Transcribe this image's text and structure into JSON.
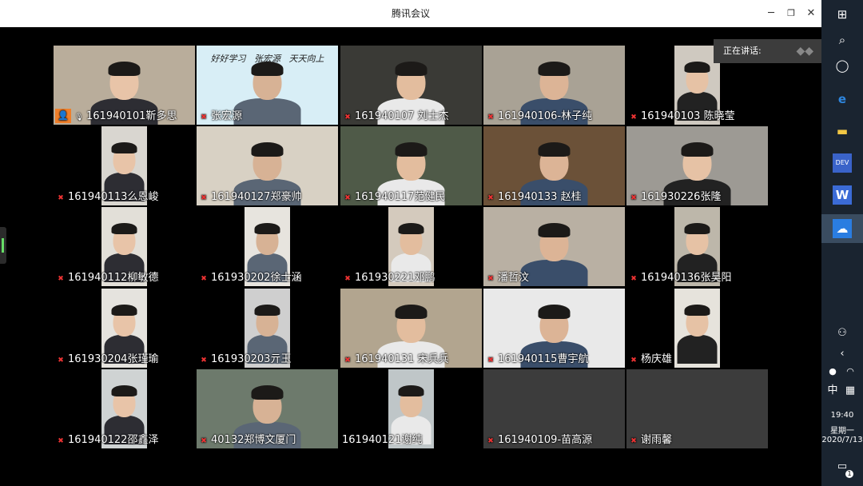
{
  "window": {
    "title": "腾讯会议",
    "minimize": "─",
    "restore": "❐",
    "close": "✕"
  },
  "speaking": {
    "label": "正在讲话:"
  },
  "participants": [
    {
      "name": "161940101靳多思",
      "bg": "#b9ad9b",
      "host": true,
      "mic": "on"
    },
    {
      "name": "张宏源",
      "bg": "#d8eef6",
      "mic": "muted",
      "banner": "好好学习   张宏源   天天向上"
    },
    {
      "name": "161940107  刘士杰",
      "bg": "#3a3a36",
      "mic": "muted"
    },
    {
      "name": "161940106-林子纯",
      "bg": "#a9a295",
      "mic": "muted"
    },
    {
      "name": "161940103 陈晓莹",
      "bg": "#cfc9c0",
      "mic": "muted"
    },
    {
      "name": "161940113么恩峻",
      "bg": "#d9d6d0",
      "mic": "muted"
    },
    {
      "name": "161940127郑豪帅",
      "bg": "#d8d1c4",
      "mic": "muted"
    },
    {
      "name": "161940117范健民",
      "bg": "#4f5a48",
      "mic": "muted"
    },
    {
      "name": "161940133 赵桂",
      "bg": "#6b5138",
      "mic": "muted"
    },
    {
      "name": "161930226张隆",
      "bg": "#9d9a94",
      "mic": "muted"
    },
    {
      "name": "161940112柳敏德",
      "bg": "#e2dfd8",
      "mic": "muted"
    },
    {
      "name": "161930202徐士涵",
      "bg": "#e7e4de",
      "mic": "muted"
    },
    {
      "name": "161930221邓鹏",
      "bg": "#d4cabd",
      "mic": "muted"
    },
    {
      "name": "潘哲汶",
      "bg": "#b9b0a3",
      "mic": "muted"
    },
    {
      "name": "161940136张昊阳",
      "bg": "#bdb7aa",
      "mic": "muted"
    },
    {
      "name": "161930204张瑾瑜",
      "bg": "#e5e3de",
      "mic": "muted"
    },
    {
      "name": "161930203亓玉",
      "bg": "#cfcfcf",
      "mic": "muted"
    },
    {
      "name": "161940131 宋兵兵",
      "bg": "#b2a58f",
      "mic": "muted"
    },
    {
      "name": "161940115曹宇航",
      "bg": "#e9e9e9",
      "mic": "muted"
    },
    {
      "name": "杨庆雄",
      "bg": "#e6e3dc",
      "mic": "muted"
    },
    {
      "name": "161940122邵鑫泽",
      "bg": "#cfd3d3",
      "mic": "muted"
    },
    {
      "name": "40132郑博文厦门",
      "bg": "#6d7a6c",
      "mic": "muted"
    },
    {
      "name": "161940121谢纯",
      "bg": "#bfc6c8",
      "mic": "none"
    },
    {
      "name": "161940109-苗高源",
      "bg": "#3c3c3c",
      "mic": "muted",
      "empty": true
    },
    {
      "name": "谢雨馨",
      "bg": "#3c3c3c",
      "mic": "muted",
      "empty": true
    }
  ],
  "taskbar": {
    "icons": [
      "windows-logo-icon",
      "search-icon",
      "cortana-icon",
      "edge-browser-icon",
      "file-explorer-icon",
      "dev-tool-icon",
      "wps-icon",
      "tencent-meeting-icon",
      "people-icon",
      "chevron-left-icon",
      "qq-icon",
      "wifi-icon",
      "calendar-grid-icon",
      "notification-icon"
    ],
    "ime": "中",
    "time": "19:40",
    "weekday": "星期一",
    "date": "2020/7/13",
    "notifications": "1"
  },
  "colors": {
    "accent": "#f07f2a",
    "muted_mic": "#ee3333",
    "taskbar": "#1a2430"
  }
}
